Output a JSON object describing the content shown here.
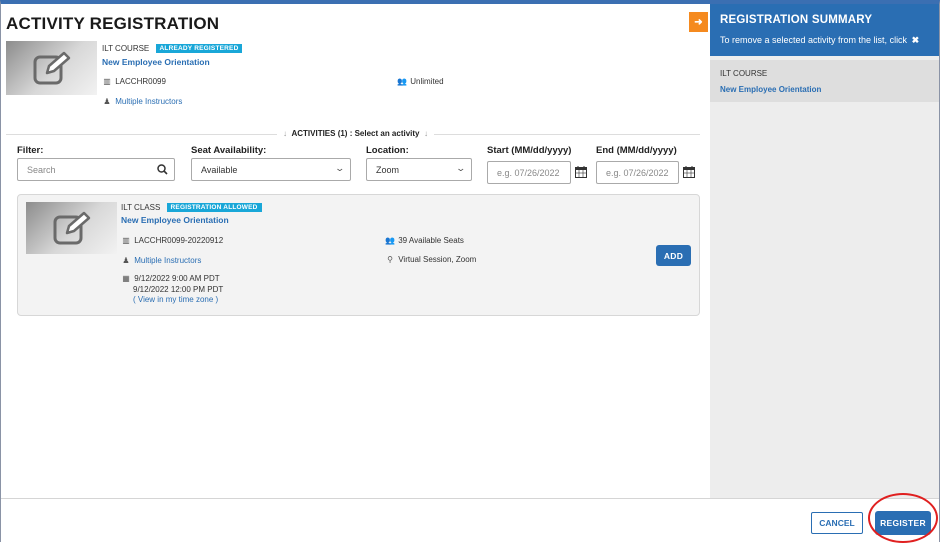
{
  "page": {
    "title": "ACTIVITY REGISTRATION"
  },
  "course": {
    "type": "ILT COURSE",
    "status_badge": "ALREADY REGISTERED",
    "name": "New Employee Orientation",
    "code": "LACCHR0099",
    "capacity": "Unlimited",
    "instructors": "Multiple Instructors"
  },
  "activities": {
    "label": "ACTIVITIES (1) : Select an activity"
  },
  "filters": {
    "filter_label": "Filter:",
    "search_placeholder": "Search",
    "seat_label": "Seat Availability:",
    "seat_value": "Available",
    "location_label": "Location:",
    "location_value": "Zoom",
    "start_label": "Start (MM/dd/yyyy)",
    "start_placeholder": "e.g. 07/26/2022",
    "end_label": "End (MM/dd/yyyy)",
    "end_placeholder": "e.g. 07/26/2022"
  },
  "class_card": {
    "type": "ILT CLASS",
    "status_badge": "REGISTRATION ALLOWED",
    "name": "New Employee Orientation",
    "code": "LACCHR0099-20220912",
    "seats": "39 Available Seats",
    "location": "Virtual Session, Zoom",
    "instructors": "Multiple Instructors",
    "start": "9/12/2022 9:00 AM PDT",
    "end": "9/12/2022 12:00 PM PDT",
    "timezone_link": "( View in my time zone )",
    "add_label": "ADD"
  },
  "summary": {
    "title": "REGISTRATION SUMMARY",
    "subtitle": "To remove a selected activity from the list, click",
    "item_type": "ILT COURSE",
    "item_name": "New Employee Orientation"
  },
  "footer": {
    "cancel_label": "CANCEL",
    "register_label": "REGISTER"
  },
  "colors": {
    "primary": "#2a6eb3",
    "badge": "#19a7d8",
    "accent_orange": "#f58a1f",
    "highlight_circle": "#e02020"
  }
}
